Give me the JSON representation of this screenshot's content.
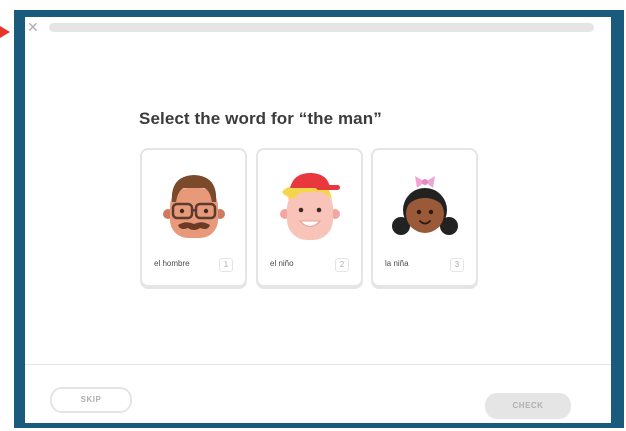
{
  "header": {
    "close_icon": "close-icon",
    "progress_fraction": 0
  },
  "main": {
    "prompt": "Select the word for “the man”",
    "cards": [
      {
        "label": "el hombre",
        "key": "1",
        "icon": "man-avatar-icon"
      },
      {
        "label": "el niño",
        "key": "2",
        "icon": "boy-avatar-icon"
      },
      {
        "label": "la niña",
        "key": "3",
        "icon": "girl-avatar-icon"
      }
    ]
  },
  "footer": {
    "skip_label": "SKIP",
    "check_label": "CHECK"
  },
  "colors": {
    "frame": "#1a5b7d",
    "border": "#e5e5e5",
    "text": "#3c3c3c",
    "muted": "#afafaf",
    "annotation_arrow": "#e8352b"
  }
}
